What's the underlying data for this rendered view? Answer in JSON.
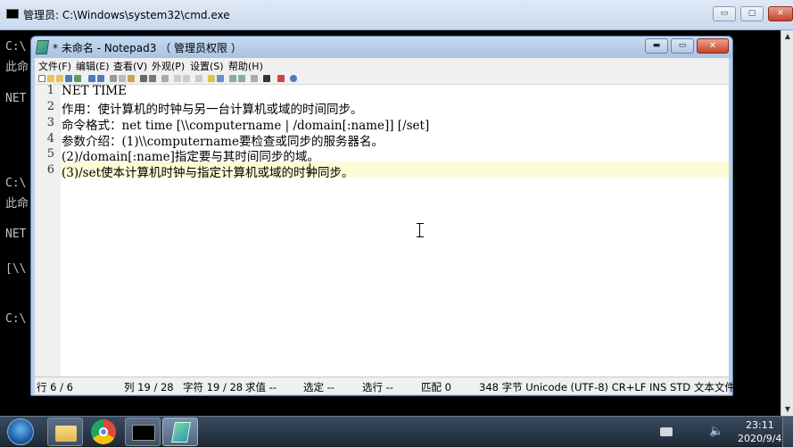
{
  "cmd_window": {
    "title": "管理员: C:\\Windows\\system32\\cmd.exe",
    "min_label": "▭",
    "max_label": "▢",
    "close_label": "✕",
    "visible_lines": [
      "C:\\",
      "此命",
      "NET",
      "C:\\",
      "此命",
      "NET",
      "[\\\\",
      "C:\\"
    ]
  },
  "notepad": {
    "title": "* 未命名 - Notepad3 （ 管理员权限 ）",
    "min_label": "▬",
    "max_label": "▭",
    "close_label": "✕",
    "menu": [
      "文件(F)",
      "编辑(E)",
      "查看(V)",
      "外观(P)",
      "设置(S)",
      "帮助(H)"
    ],
    "line_numbers": [
      "1",
      "2",
      "3",
      "4",
      "5",
      "6"
    ],
    "lines": [
      "NET TIME",
      "作用：使计算机的时钟与另一台计算机或域的时间同步。",
      "命令格式：net time [\\\\computername | /domain[:name]] [/set]",
      "参数介绍：(1)\\\\computername要检查或同步的服务器名。",
      "(2)/domain[:name]指定要与其时间同步的域。",
      "(3)/set使本计算机时钟与指定计算机或域的时钟同步。"
    ],
    "status": {
      "line": "行 6 / 6",
      "col": "列 19 / 28",
      "char": "字符 19 / 28",
      "eval": "求值 --",
      "sel": "选定 --",
      "sel_lines": "选行 --",
      "match": "匹配 0",
      "info": "348 字节 Unicode (UTF-8) CR+LF INS STD 文本文件"
    }
  },
  "taskbar": {
    "time": "23:11",
    "date": "2020/9/4",
    "speaker_icon": "🔈"
  },
  "colors": {
    "current_line_bg": "#fdfbd6",
    "cmd_bg": "#000000",
    "cmd_text": "#c0c0c0"
  }
}
